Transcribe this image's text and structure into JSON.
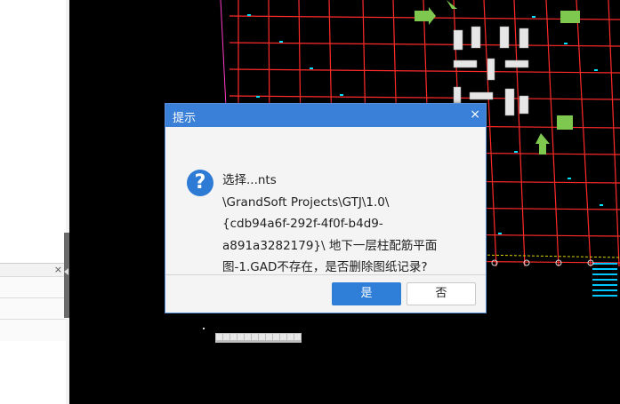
{
  "left_panel": {
    "sub_close": "×"
  },
  "dialog": {
    "title": "提示",
    "close_glyph": "×",
    "icon": "question-icon",
    "message": "选择...nts\n\\GrandSoft Projects\\GTJ\\1.0\\\n{cdb94a6f-292f-4f0f-b4d9-\na891a3282179}\\ 地下一层柱配筋平面\n图-1.GAD不存在，是否删除图纸记录?",
    "yes_label": "是",
    "no_label": "否"
  },
  "colors": {
    "grid": "#ff2a2a",
    "marker": "#00e0ff",
    "accent": "#3a80d8"
  }
}
